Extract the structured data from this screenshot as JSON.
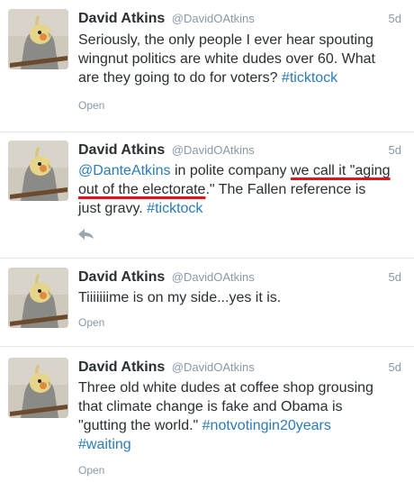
{
  "tweets": [
    {
      "fullname": "David Atkins",
      "username": "@DavidOAtkins",
      "time": "5d",
      "lines": [
        [
          {
            "t": "Seriously, the only people I ever hear spouting"
          }
        ],
        [
          {
            "t": "wingnut politics are white dudes over 60. What"
          }
        ],
        [
          {
            "t": "are they going to do for voters? "
          },
          {
            "t": "#ticktock",
            "link": true
          }
        ]
      ],
      "action": "Open"
    },
    {
      "fullname": "David Atkins",
      "username": "@DavidOAtkins",
      "time": "5d",
      "lines": [
        [
          {
            "t": "@DanteAtkins",
            "link": true
          },
          {
            "t": " in polite company "
          },
          {
            "t": "we call it \"aging",
            "underline": true
          }
        ],
        [
          {
            "t": "out of the electorate",
            "underline": true
          },
          {
            "t": ".\" The Fallen reference is"
          }
        ],
        [
          {
            "t": "just gravy. "
          },
          {
            "t": "#ticktock",
            "link": true
          }
        ]
      ],
      "action_icon": "reply-icon"
    },
    {
      "fullname": "David Atkins",
      "username": "@DavidOAtkins",
      "time": "5d",
      "lines": [
        [
          {
            "t": "Tiiiiiiime is on my side...yes it is."
          }
        ]
      ],
      "action": "Open"
    },
    {
      "fullname": "David Atkins",
      "username": "@DavidOAtkins",
      "time": "5d",
      "lines": [
        [
          {
            "t": "Three old white dudes at coffee shop grousing"
          }
        ],
        [
          {
            "t": "that climate change is fake and Obama is"
          }
        ],
        [
          {
            "t": "\"gutting the world.\" "
          },
          {
            "t": "#notvotingin20years",
            "link": true
          }
        ],
        [
          {
            "t": "#waiting",
            "link": true
          }
        ]
      ],
      "action": "Open"
    }
  ]
}
